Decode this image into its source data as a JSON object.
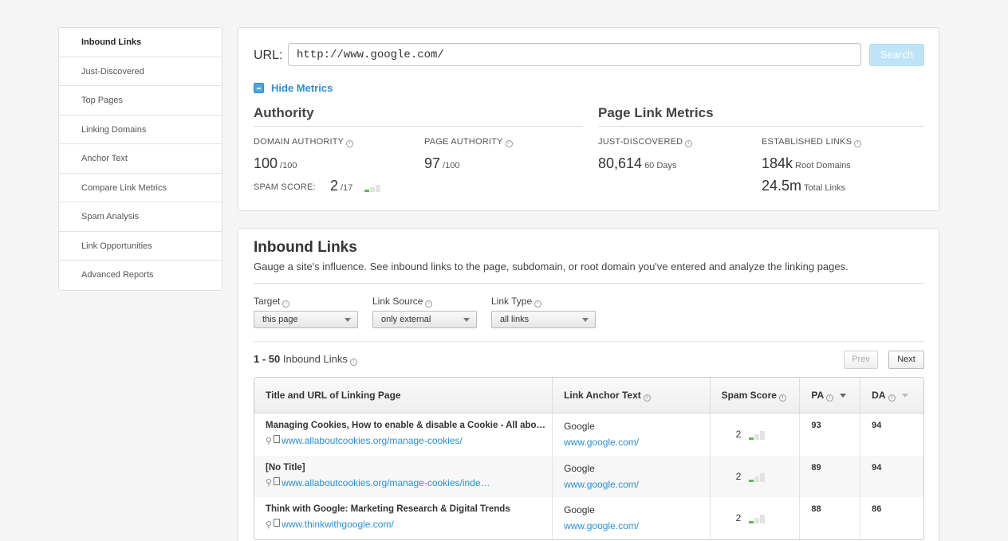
{
  "sidebar": {
    "items": [
      {
        "label": "Inbound Links"
      },
      {
        "label": "Just-Discovered"
      },
      {
        "label": "Top Pages"
      },
      {
        "label": "Linking Domains"
      },
      {
        "label": "Anchor Text"
      },
      {
        "label": "Compare Link Metrics"
      },
      {
        "label": "Spam Analysis"
      },
      {
        "label": "Link Opportunities"
      },
      {
        "label": "Advanced Reports"
      }
    ]
  },
  "search": {
    "url_label": "URL:",
    "url_value": "http://www.google.com/",
    "button_label": "Search"
  },
  "metrics": {
    "toggle_label": "Hide Metrics",
    "authority_title": "Authority",
    "page_link_title": "Page Link Metrics",
    "domain_authority": {
      "label": "DOMAIN AUTHORITY",
      "value": "100",
      "sub": "/100"
    },
    "page_authority": {
      "label": "PAGE AUTHORITY",
      "value": "97",
      "sub": "/100"
    },
    "spam_score": {
      "label": "SPAM SCORE:",
      "value": "2",
      "sub": "/17",
      "level": 2
    },
    "just_discovered": {
      "label": "JUST-DISCOVERED",
      "value": "80,614",
      "sub": "60 Days"
    },
    "established": {
      "label": "ESTABLISHED LINKS",
      "value1": "184k",
      "sub1": "Root Domains",
      "value2": "24.5m",
      "sub2": "Total Links"
    }
  },
  "inbound": {
    "title": "Inbound Links",
    "description": "Gauge a site's influence. See inbound links to the page, subdomain, or root domain you've entered and analyze the linking pages.",
    "filters": {
      "target": {
        "label": "Target",
        "value": "this page"
      },
      "source": {
        "label": "Link Source",
        "value": "only external"
      },
      "type": {
        "label": "Link Type",
        "value": "all links"
      }
    },
    "count_range": "1 - 50",
    "count_label": "Inbound Links",
    "prev_label": "Prev",
    "next_label": "Next",
    "columns": {
      "title_url": "Title and URL of Linking Page",
      "anchor": "Link Anchor Text",
      "spam": "Spam Score",
      "pa": "PA",
      "da": "DA"
    },
    "rows": [
      {
        "title": "Managing Cookies, How to enable & disable a Cookie - All abo…",
        "url": "www.allaboutcookies.org/manage-cookies/",
        "anchor": "Google",
        "anchor_url": "www.google.com/",
        "spam": "2",
        "pa": "93",
        "da": "94"
      },
      {
        "title": "[No Title]",
        "url": "www.allaboutcookies.org/manage-cookies/inde…",
        "anchor": "Google",
        "anchor_url": "www.google.com/",
        "spam": "2",
        "pa": "89",
        "da": "94"
      },
      {
        "title": "Think with Google: Marketing Research & Digital Trends",
        "url": "www.thinkwithgoogle.com/",
        "anchor": "Google",
        "anchor_url": "www.google.com/",
        "spam": "2",
        "pa": "88",
        "da": "86"
      }
    ]
  },
  "colors": {
    "accent": "#2a8fd0",
    "spam_green": "#5cb85c"
  }
}
